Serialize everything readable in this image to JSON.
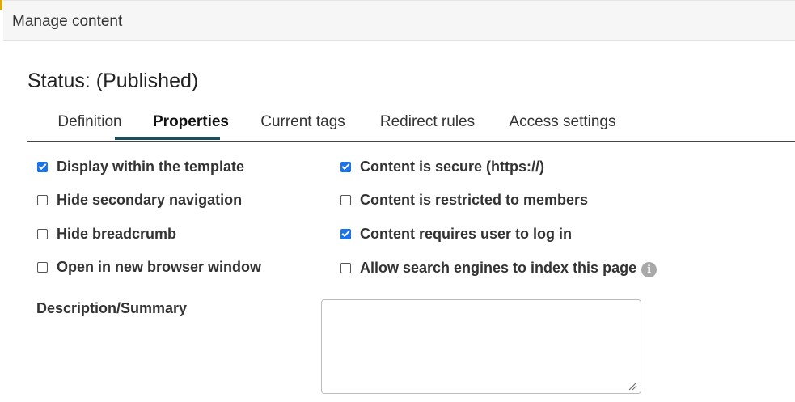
{
  "dialog": {
    "title": "Manage content"
  },
  "status": {
    "text": "Status: (Published)"
  },
  "tabs": [
    {
      "label": "Definition",
      "active": false
    },
    {
      "label": "Properties",
      "active": true
    },
    {
      "label": "Current tags",
      "active": false
    },
    {
      "label": "Redirect rules",
      "active": false
    },
    {
      "label": "Access settings",
      "active": false
    }
  ],
  "options_left": [
    {
      "label": "Display within the template",
      "checked": true
    },
    {
      "label": "Hide secondary navigation",
      "checked": false
    },
    {
      "label": "Hide breadcrumb",
      "checked": false
    },
    {
      "label": "Open in new browser window",
      "checked": false
    }
  ],
  "options_right": [
    {
      "label": "Content is secure (https://)",
      "checked": true
    },
    {
      "label": "Content is restricted to members",
      "checked": false
    },
    {
      "label": "Content requires user to log in",
      "checked": true
    },
    {
      "label": "Allow search engines to index this page",
      "checked": false,
      "icon": "info-icon"
    }
  ],
  "description": {
    "label": "Description/Summary",
    "value": ""
  },
  "colors": {
    "checkbox_checked": "#1a73e8",
    "tab_underline": "#174f5e",
    "header_bg": "#f6f6f6"
  }
}
